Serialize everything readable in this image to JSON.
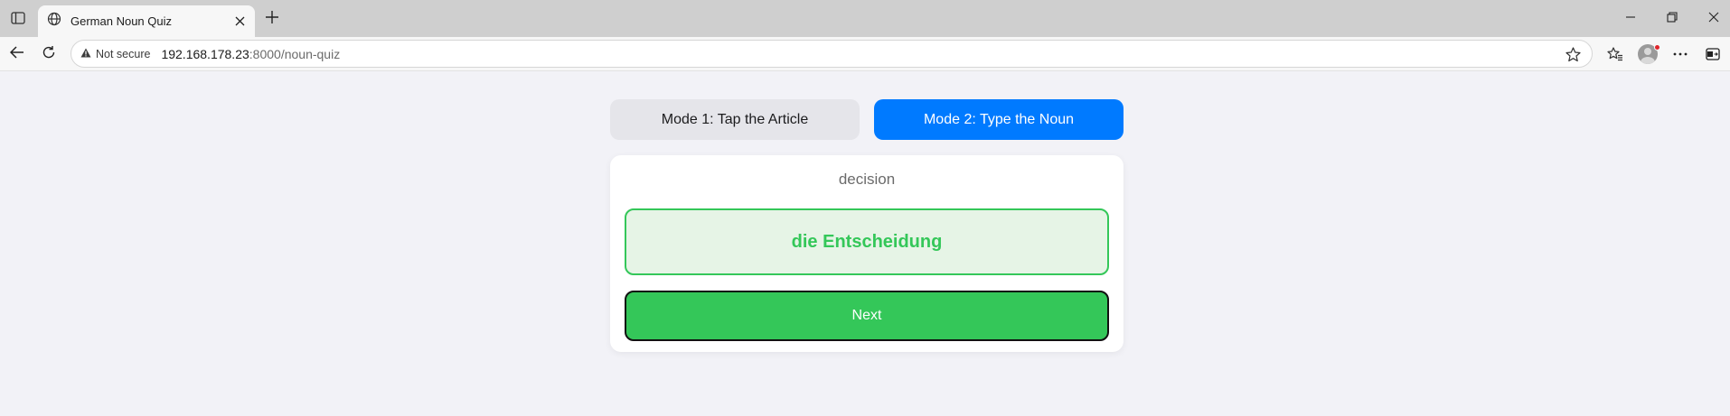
{
  "browser": {
    "tab_title": "German Noun Quiz",
    "security_label": "Not secure",
    "url_host": "192.168.178.23",
    "url_rest": ":8000/noun-quiz",
    "icons": {
      "sidebar": "sidebar-toggle-icon",
      "tab_favicon": "globe-icon",
      "tab_close": "close-icon",
      "new_tab": "plus-icon",
      "back": "back-arrow-icon",
      "reload": "reload-icon",
      "warning": "warning-icon",
      "favorite": "star-icon",
      "favorites_list": "favorites-icon",
      "profile": "avatar",
      "menu": "more-icon",
      "split": "split-screen-icon"
    }
  },
  "quiz": {
    "mode1_label": "Mode 1: Tap the Article",
    "mode2_label": "Mode 2: Type the Noun",
    "active_mode": 2,
    "prompt": "decision",
    "answer": "die Entscheidung",
    "next_label": "Next"
  },
  "colors": {
    "accent_blue": "#007aff",
    "success_green": "#34c759",
    "success_bg": "#e6f4e6",
    "inactive_mode": "#e5e5ea"
  }
}
